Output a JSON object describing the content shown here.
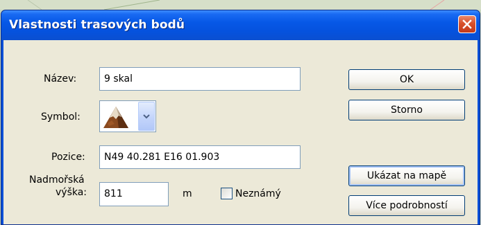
{
  "window": {
    "title": "Vlastnosti trasových bodů"
  },
  "form": {
    "name_label": "Název:",
    "name_value": "9 skal",
    "symbol_label": "Symbol:",
    "symbol_icon": "mountain-peak-icon",
    "position_label": "Pozice:",
    "position_value": "N49 40.281 E16 01.903",
    "altitude_label_line1": "Nadmořská",
    "altitude_label_line2": "výška:",
    "altitude_value": "811",
    "altitude_unit": "m",
    "unknown_label": "Neznámý",
    "unknown_checked": false
  },
  "buttons": {
    "ok": "OK",
    "cancel": "Storno",
    "show_on_map": "Ukázat na mapě",
    "more_details": "Více podrobností"
  },
  "colors": {
    "title_bar": "#0658e6",
    "client_bg": "#ece9d8",
    "close_button": "#d8512b"
  }
}
